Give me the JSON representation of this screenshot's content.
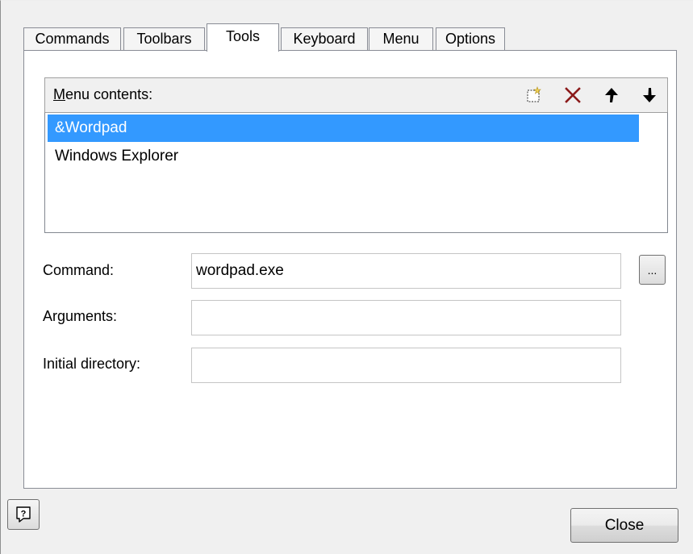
{
  "tabs": [
    {
      "label": "Commands"
    },
    {
      "label": "Toolbars"
    },
    {
      "label": "Tools"
    },
    {
      "label": "Keyboard"
    },
    {
      "label": "Menu"
    },
    {
      "label": "Options"
    }
  ],
  "active_tab": "Tools",
  "menu_contents": {
    "label_underlined": "M",
    "label_rest": "enu contents:",
    "toolbar_icons": [
      "new-item-icon",
      "delete-icon",
      "move-up-icon",
      "move-down-icon"
    ],
    "items": [
      {
        "label": "&Wordpad",
        "selected": true
      },
      {
        "label": "Windows Explorer",
        "selected": false
      }
    ]
  },
  "fields": {
    "command": {
      "label": "Command:",
      "value": "wordpad.exe"
    },
    "arguments": {
      "label": "Arguments:",
      "value": ""
    },
    "initial_directory": {
      "label": "Initial directory:",
      "value": ""
    }
  },
  "browse_button": {
    "label": "..."
  },
  "help_button": {
    "icon": "help-icon"
  },
  "close_button": {
    "label": "Close"
  },
  "colors": {
    "selection": "#3399ff",
    "delete_icon": "#8b1a1a"
  }
}
